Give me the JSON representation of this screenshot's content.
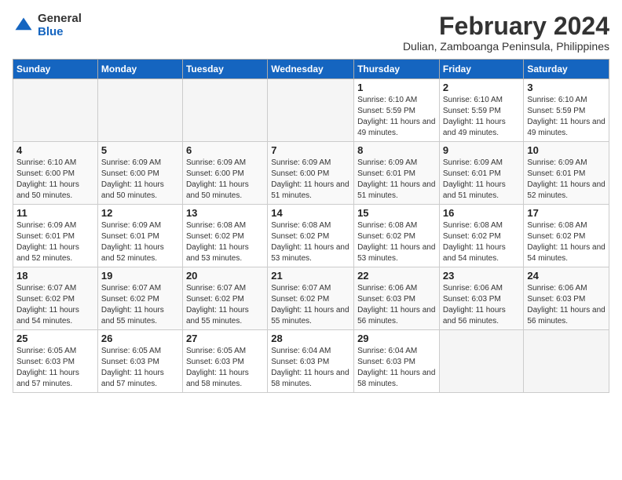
{
  "logo": {
    "general": "General",
    "blue": "Blue"
  },
  "title": "February 2024",
  "subtitle": "Dulian, Zamboanga Peninsula, Philippines",
  "days_of_week": [
    "Sunday",
    "Monday",
    "Tuesday",
    "Wednesday",
    "Thursday",
    "Friday",
    "Saturday"
  ],
  "weeks": [
    [
      {
        "day": "",
        "info": ""
      },
      {
        "day": "",
        "info": ""
      },
      {
        "day": "",
        "info": ""
      },
      {
        "day": "",
        "info": ""
      },
      {
        "day": "1",
        "info": "Sunrise: 6:10 AM\nSunset: 5:59 PM\nDaylight: 11 hours\nand 49 minutes."
      },
      {
        "day": "2",
        "info": "Sunrise: 6:10 AM\nSunset: 5:59 PM\nDaylight: 11 hours\nand 49 minutes."
      },
      {
        "day": "3",
        "info": "Sunrise: 6:10 AM\nSunset: 5:59 PM\nDaylight: 11 hours\nand 49 minutes."
      }
    ],
    [
      {
        "day": "4",
        "info": "Sunrise: 6:10 AM\nSunset: 6:00 PM\nDaylight: 11 hours\nand 50 minutes."
      },
      {
        "day": "5",
        "info": "Sunrise: 6:09 AM\nSunset: 6:00 PM\nDaylight: 11 hours\nand 50 minutes."
      },
      {
        "day": "6",
        "info": "Sunrise: 6:09 AM\nSunset: 6:00 PM\nDaylight: 11 hours\nand 50 minutes."
      },
      {
        "day": "7",
        "info": "Sunrise: 6:09 AM\nSunset: 6:00 PM\nDaylight: 11 hours\nand 51 minutes."
      },
      {
        "day": "8",
        "info": "Sunrise: 6:09 AM\nSunset: 6:01 PM\nDaylight: 11 hours\nand 51 minutes."
      },
      {
        "day": "9",
        "info": "Sunrise: 6:09 AM\nSunset: 6:01 PM\nDaylight: 11 hours\nand 51 minutes."
      },
      {
        "day": "10",
        "info": "Sunrise: 6:09 AM\nSunset: 6:01 PM\nDaylight: 11 hours\nand 52 minutes."
      }
    ],
    [
      {
        "day": "11",
        "info": "Sunrise: 6:09 AM\nSunset: 6:01 PM\nDaylight: 11 hours\nand 52 minutes."
      },
      {
        "day": "12",
        "info": "Sunrise: 6:09 AM\nSunset: 6:01 PM\nDaylight: 11 hours\nand 52 minutes."
      },
      {
        "day": "13",
        "info": "Sunrise: 6:08 AM\nSunset: 6:02 PM\nDaylight: 11 hours\nand 53 minutes."
      },
      {
        "day": "14",
        "info": "Sunrise: 6:08 AM\nSunset: 6:02 PM\nDaylight: 11 hours\nand 53 minutes."
      },
      {
        "day": "15",
        "info": "Sunrise: 6:08 AM\nSunset: 6:02 PM\nDaylight: 11 hours\nand 53 minutes."
      },
      {
        "day": "16",
        "info": "Sunrise: 6:08 AM\nSunset: 6:02 PM\nDaylight: 11 hours\nand 54 minutes."
      },
      {
        "day": "17",
        "info": "Sunrise: 6:08 AM\nSunset: 6:02 PM\nDaylight: 11 hours\nand 54 minutes."
      }
    ],
    [
      {
        "day": "18",
        "info": "Sunrise: 6:07 AM\nSunset: 6:02 PM\nDaylight: 11 hours\nand 54 minutes."
      },
      {
        "day": "19",
        "info": "Sunrise: 6:07 AM\nSunset: 6:02 PM\nDaylight: 11 hours\nand 55 minutes."
      },
      {
        "day": "20",
        "info": "Sunrise: 6:07 AM\nSunset: 6:02 PM\nDaylight: 11 hours\nand 55 minutes."
      },
      {
        "day": "21",
        "info": "Sunrise: 6:07 AM\nSunset: 6:02 PM\nDaylight: 11 hours\nand 55 minutes."
      },
      {
        "day": "22",
        "info": "Sunrise: 6:06 AM\nSunset: 6:03 PM\nDaylight: 11 hours\nand 56 minutes."
      },
      {
        "day": "23",
        "info": "Sunrise: 6:06 AM\nSunset: 6:03 PM\nDaylight: 11 hours\nand 56 minutes."
      },
      {
        "day": "24",
        "info": "Sunrise: 6:06 AM\nSunset: 6:03 PM\nDaylight: 11 hours\nand 56 minutes."
      }
    ],
    [
      {
        "day": "25",
        "info": "Sunrise: 6:05 AM\nSunset: 6:03 PM\nDaylight: 11 hours\nand 57 minutes."
      },
      {
        "day": "26",
        "info": "Sunrise: 6:05 AM\nSunset: 6:03 PM\nDaylight: 11 hours\nand 57 minutes."
      },
      {
        "day": "27",
        "info": "Sunrise: 6:05 AM\nSunset: 6:03 PM\nDaylight: 11 hours\nand 58 minutes."
      },
      {
        "day": "28",
        "info": "Sunrise: 6:04 AM\nSunset: 6:03 PM\nDaylight: 11 hours\nand 58 minutes."
      },
      {
        "day": "29",
        "info": "Sunrise: 6:04 AM\nSunset: 6:03 PM\nDaylight: 11 hours\nand 58 minutes."
      },
      {
        "day": "",
        "info": ""
      },
      {
        "day": "",
        "info": ""
      }
    ]
  ]
}
